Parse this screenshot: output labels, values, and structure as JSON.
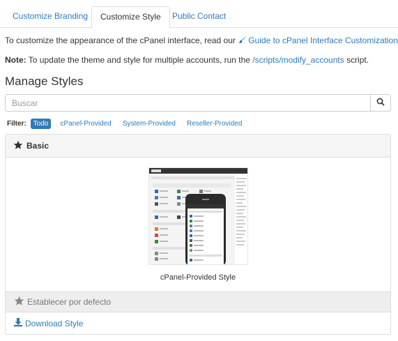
{
  "tabs": [
    {
      "label": "Customize Branding"
    },
    {
      "label": "Customize Style"
    },
    {
      "label": "Public Contact"
    }
  ],
  "intro": {
    "text": "To customize the appearance of the cPanel interface, read our",
    "link": "Guide to cPanel Interface Customization",
    "end": "."
  },
  "note": {
    "label": "Note:",
    "text": "To update the theme and style for multiple accounts, run the",
    "link": "/scripts/modify_accounts",
    "end": "script."
  },
  "heading": "Manage Styles",
  "search": {
    "placeholder": "Buscar",
    "value": ""
  },
  "filter": {
    "label": "Filter:",
    "options": [
      "Todo",
      "cPanel-Provided",
      "System-Provided",
      "Reseller-Provided"
    ],
    "selected": "Todo"
  },
  "style_card": {
    "title": "Basic",
    "caption": "cPanel-Provided Style",
    "set_default": "Establecer por defecto",
    "download": "Download Style"
  },
  "colors": {
    "accent": "#2a7bbf",
    "active_chip": "#337ab7",
    "thumb_header": "#333333"
  },
  "icons": [
    "paint-brush-icon",
    "search-icon",
    "star-icon",
    "download-icon"
  ]
}
